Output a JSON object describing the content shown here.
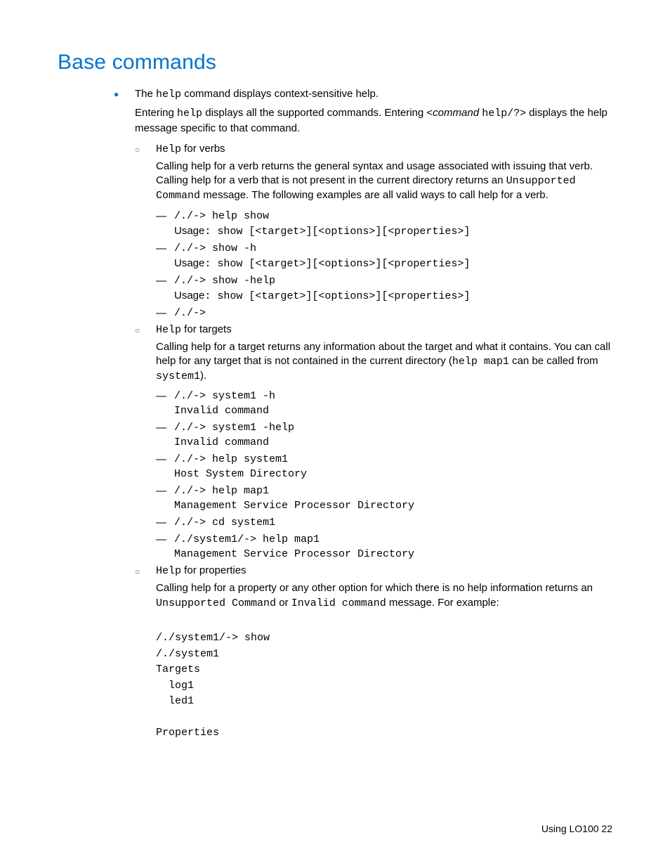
{
  "title": "Base commands",
  "p1_a": "The ",
  "p1_code": "help",
  "p1_b": " command displays context-sensitive help.",
  "p2_a": "Entering ",
  "p2_code1": "help",
  "p2_b": " displays all the supported commands. Entering <",
  "p2_ital": "command ",
  "p2_code2": "help/?",
  "p2_c": "> displays the help message specific to that command.",
  "verbs": {
    "head_code": "Help",
    "head_text": " for verbs",
    "para_a": "Calling help for a verb returns the general syntax and usage associated with issuing that verb. Calling help for a verb that is not present in the current directory returns an ",
    "para_code": "Unsupported Command",
    "para_b": " message. The following examples are all valid ways to call help for a verb.",
    "items": [
      {
        "cmd": "/./-> help show",
        "usage_label": "Usage",
        "usage_val": ": show [<target>][<options>][<properties>]"
      },
      {
        "cmd": "/./-> show -h",
        "usage_label": "Usage",
        "usage_val": ": show [<target>][<options>][<properties>]"
      },
      {
        "cmd": "/./-> show -help",
        "usage_label": "Usage",
        "usage_val": ": show [<target>][<options>][<properties>]"
      },
      {
        "cmd": "/./->"
      }
    ]
  },
  "targets": {
    "head_code": "Help",
    "head_text": " for targets",
    "para_a": "Calling help for a target returns any information about the target and what it contains. You can call help for any target that is not contained in the current directory (",
    "para_code1": "help map1",
    "para_b": " can be called from ",
    "para_code2": "system1",
    "para_c": ").",
    "items": [
      {
        "cmd": "/./-> system1 -h",
        "out": "Invalid command"
      },
      {
        "cmd": "/./-> system1 -help",
        "out": "Invalid command"
      },
      {
        "cmd": "/./-> help system1",
        "out": "Host System Directory"
      },
      {
        "cmd": "/./-> help map1",
        "out": "Management Service Processor Directory"
      },
      {
        "cmd": "/./-> cd system1"
      },
      {
        "cmd": "/./system1/-> help map1",
        "out": "Management Service Processor Directory"
      }
    ]
  },
  "props": {
    "head_code": "Help",
    "head_text": " for properties",
    "para_a": "Calling help for a property or any other option for which there is no help information returns an ",
    "para_code1": "Unsupported Command",
    "para_b": " or ",
    "para_code2": "Invalid command",
    "para_c": " message. For example:",
    "lines": [
      "/./system1/-> show",
      "/./system1",
      "Targets",
      "  log1",
      "  led1",
      "",
      "Properties"
    ]
  },
  "footer_a": "Using LO100",
  "footer_b": "   22"
}
